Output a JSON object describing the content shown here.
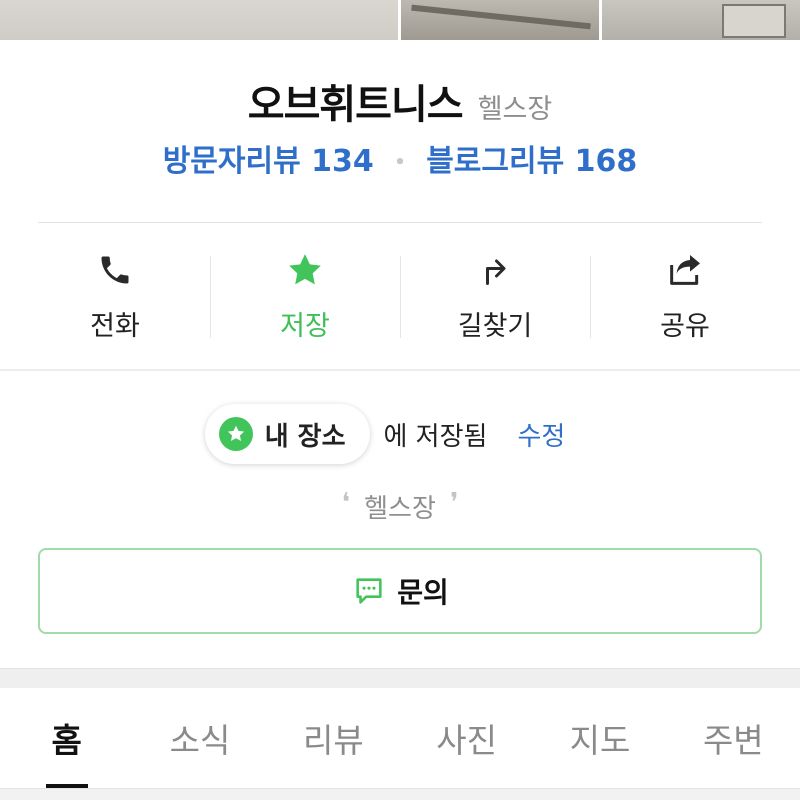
{
  "place": {
    "name": "오브휘트니스",
    "category": "헬스장"
  },
  "reviews": {
    "visitor": "방문자리뷰 134",
    "separator": "•",
    "blog": "블로그리뷰 168"
  },
  "actions": [
    {
      "label": "전화",
      "icon": "phone-icon"
    },
    {
      "label": "저장",
      "icon": "star-icon",
      "active": true
    },
    {
      "label": "길찾기",
      "icon": "directions-arrow-icon"
    },
    {
      "label": "공유",
      "icon": "share-icon"
    }
  ],
  "saved": {
    "list_name": "내 장소",
    "suffix": "에 저장됨",
    "edit_label": "수정",
    "memo": "헬스장",
    "quote_open": "❛",
    "quote_close": "❜"
  },
  "inquiry": {
    "label": "문의",
    "icon": "chat-bubble-icon"
  },
  "tabs": [
    {
      "label": "홈",
      "active": true
    },
    {
      "label": "소식"
    },
    {
      "label": "리뷰"
    },
    {
      "label": "사진"
    },
    {
      "label": "지도"
    },
    {
      "label": "주변"
    }
  ],
  "colors": {
    "accent_green": "#41c55a",
    "link_blue": "#2f6fc9",
    "muted_gray": "#8e8e8e"
  }
}
